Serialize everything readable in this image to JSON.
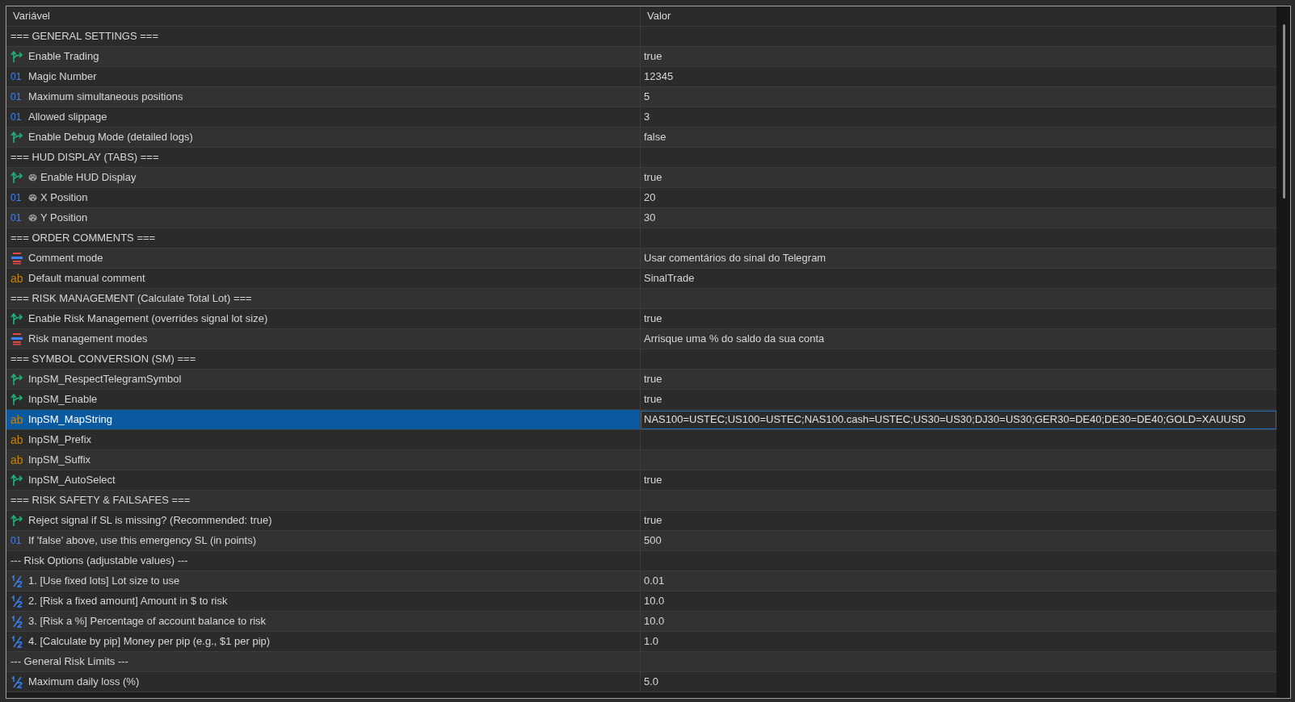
{
  "table": {
    "columns": [
      "Variável",
      "Valor"
    ],
    "rows": [
      {
        "kind": "section",
        "name": "=== GENERAL SETTINGS ===",
        "value": "",
        "selected": false
      },
      {
        "kind": "bool",
        "name": "Enable Trading",
        "value": "true",
        "selected": false
      },
      {
        "kind": "int",
        "type_label": "01",
        "name": "Magic Number",
        "value": "12345",
        "selected": false
      },
      {
        "kind": "int",
        "type_label": "01",
        "name": "Maximum simultaneous positions",
        "value": "5",
        "selected": false
      },
      {
        "kind": "int",
        "type_label": "01",
        "name": "Allowed slippage",
        "value": "3",
        "selected": false
      },
      {
        "kind": "bool",
        "name": "Enable Debug Mode (detailed logs)",
        "value": "false",
        "selected": false
      },
      {
        "kind": "section",
        "name": "=== HUD DISPLAY (TABS) ===",
        "value": "",
        "selected": false
      },
      {
        "kind": "bool",
        "name": "Enable HUD Display",
        "value": "true",
        "selected": false,
        "palette": true
      },
      {
        "kind": "int",
        "type_label": "01",
        "name": "X Position",
        "value": "20",
        "selected": false,
        "palette": true
      },
      {
        "kind": "int",
        "type_label": "01",
        "name": "Y Position",
        "value": "30",
        "selected": false,
        "palette": true
      },
      {
        "kind": "section",
        "name": "=== ORDER COMMENTS ===",
        "value": "",
        "selected": false
      },
      {
        "kind": "enum",
        "name": "Comment mode",
        "value": "Usar comentários do sinal do Telegram",
        "selected": false
      },
      {
        "kind": "string",
        "type_label": "ab",
        "name": "Default manual comment",
        "value": "SinalTrade",
        "selected": false
      },
      {
        "kind": "section",
        "name": "=== RISK MANAGEMENT (Calculate Total Lot) ===",
        "value": "",
        "selected": false
      },
      {
        "kind": "bool",
        "name": "Enable Risk Management (overrides signal lot size)",
        "value": "true",
        "selected": false
      },
      {
        "kind": "enum",
        "name": "Risk management modes",
        "value": "Arrisque uma % do saldo da sua conta",
        "selected": false
      },
      {
        "kind": "section",
        "name": "=== SYMBOL CONVERSION (SM) ===",
        "value": "",
        "selected": false
      },
      {
        "kind": "bool",
        "name": "InpSM_RespectTelegramSymbol",
        "value": "true",
        "selected": false
      },
      {
        "kind": "bool",
        "name": "InpSM_Enable",
        "value": "true",
        "selected": false
      },
      {
        "kind": "string",
        "type_label": "ab",
        "name": "InpSM_MapString",
        "value": "NAS100=USTEC;US100=USTEC;NAS100.cash=USTEC;US30=US30;DJ30=US30;GER30=DE40;DE30=DE40;GOLD=XAUUSD",
        "selected": true
      },
      {
        "kind": "string",
        "type_label": "ab",
        "name": "InpSM_Prefix",
        "value": "",
        "selected": false
      },
      {
        "kind": "string",
        "type_label": "ab",
        "name": "InpSM_Suffix",
        "value": "",
        "selected": false
      },
      {
        "kind": "bool",
        "name": "InpSM_AutoSelect",
        "value": "true",
        "selected": false
      },
      {
        "kind": "section",
        "name": "=== RISK SAFETY & FAILSAFES ===",
        "value": "",
        "selected": false
      },
      {
        "kind": "bool",
        "name": "Reject signal if SL is missing? (Recommended: true)",
        "value": "true",
        "selected": false
      },
      {
        "kind": "int",
        "type_label": "01",
        "name": "If 'false' above, use this emergency SL (in points)",
        "value": "500",
        "selected": false
      },
      {
        "kind": "section",
        "name": "--- Risk Options (adjustable values) ---",
        "value": "",
        "selected": false
      },
      {
        "kind": "double",
        "name": "1. [Use fixed lots] Lot size to use",
        "value": "0.01",
        "selected": false
      },
      {
        "kind": "double",
        "name": "2. [Risk a fixed amount] Amount in $ to risk",
        "value": "10.0",
        "selected": false
      },
      {
        "kind": "double",
        "name": "3. [Risk a %] Percentage of account balance to risk",
        "value": "10.0",
        "selected": false
      },
      {
        "kind": "double",
        "name": "4. [Calculate by pip] Money per pip (e.g., $1 per pip)",
        "value": "1.0",
        "selected": false
      },
      {
        "kind": "section",
        "name": "--- General Risk Limits ---",
        "value": "",
        "selected": false
      },
      {
        "kind": "double",
        "name": "Maximum daily loss (%)",
        "value": "5.0",
        "selected": false
      }
    ]
  }
}
